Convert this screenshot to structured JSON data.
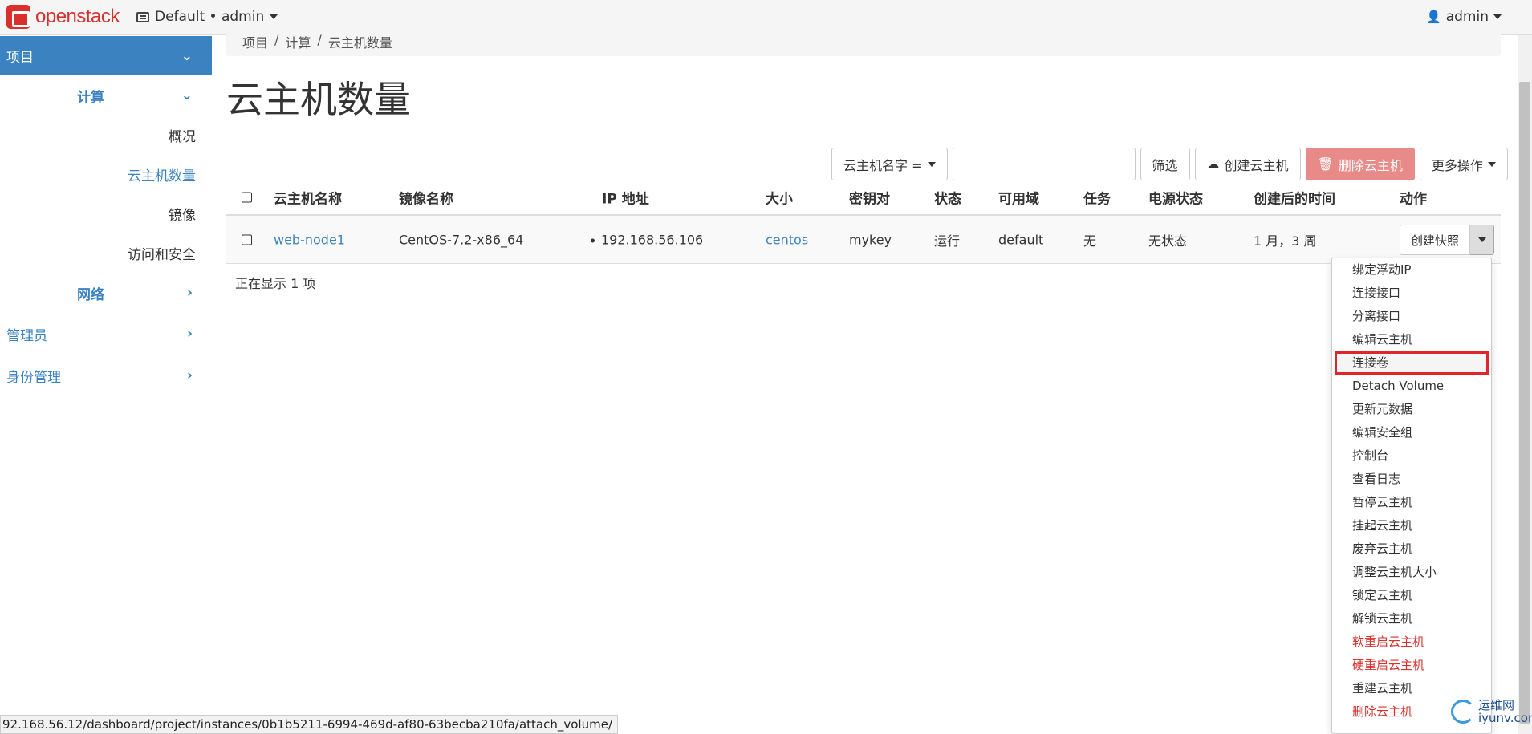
{
  "header": {
    "logo_text": "openstack",
    "project_picker": "Default • admin",
    "user": "admin"
  },
  "sidebar": {
    "project": "项目",
    "compute": "计算",
    "compute_items": [
      "概况",
      "云主机数量",
      "镜像",
      "访问和安全"
    ],
    "active_item": "云主机数量",
    "network": "网络",
    "admin": "管理员",
    "identity": "身份管理"
  },
  "breadcrumb": [
    "项目",
    "计算",
    "云主机数量"
  ],
  "page_title": "云主机数量",
  "toolbar": {
    "filter_field": "云主机名字 =",
    "filter_value": "",
    "filter_button": "筛选",
    "create_button": "创建云主机",
    "delete_button": "删除云主机",
    "more_button": "更多操作"
  },
  "table": {
    "headers": [
      "云主机名称",
      "镜像名称",
      "IP 地址",
      "大小",
      "密钥对",
      "状态",
      "可用域",
      "任务",
      "电源状态",
      "创建后的时间",
      "动作"
    ],
    "rows": [
      {
        "name": "web-node1",
        "image": "CentOS-7.2-x86_64",
        "ip": "192.168.56.106",
        "size": "centos",
        "keypair": "mykey",
        "status": "运行",
        "zone": "default",
        "task": "无",
        "power": "无状态",
        "age": "1 月，3 周",
        "action": "创建快照"
      }
    ],
    "footer": "正在显示 1 项"
  },
  "dropdown": {
    "items": [
      {
        "label": "绑定浮动IP"
      },
      {
        "label": "连接接口"
      },
      {
        "label": "分离接口"
      },
      {
        "label": "编辑云主机"
      },
      {
        "label": "连接卷"
      },
      {
        "label": "Detach Volume"
      },
      {
        "label": "更新元数据"
      },
      {
        "label": "编辑安全组"
      },
      {
        "label": "控制台"
      },
      {
        "label": "查看日志"
      },
      {
        "label": "暂停云主机"
      },
      {
        "label": "挂起云主机"
      },
      {
        "label": "废弃云主机"
      },
      {
        "label": "调整云主机大小"
      },
      {
        "label": "锁定云主机"
      },
      {
        "label": "解锁云主机"
      },
      {
        "label": "软重启云主机"
      },
      {
        "label": "硬重启云主机"
      },
      {
        "label": "重建云主机"
      },
      {
        "label": "删除云主机"
      }
    ]
  },
  "status_url": "92.168.56.12/dashboard/project/instances/0b1b5211-6994-469d-af80-63becba210fa/attach_volume/",
  "watermark": {
    "line1": "运维网",
    "line2": "iyunv.com"
  },
  "colors": {
    "accent": "#3b83c0",
    "danger": "#d9302c",
    "highlight_border": "#e0262a"
  }
}
